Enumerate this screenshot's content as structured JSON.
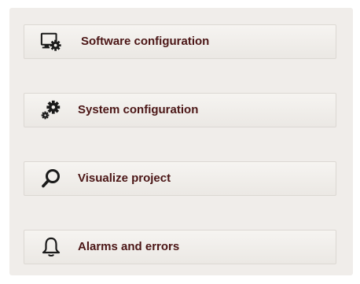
{
  "menu": {
    "items": [
      {
        "label": "Software configuration",
        "icon": "monitor-gear-icon"
      },
      {
        "label": "System configuration",
        "icon": "gears-icon"
      },
      {
        "label": "Visualize project",
        "icon": "magnifier-icon"
      },
      {
        "label": "Alarms and errors",
        "icon": "bell-icon"
      }
    ]
  },
  "colors": {
    "text": "#4b1616",
    "icon": "#1a1a1a",
    "panel_background": "#f0edea",
    "button_background": "#efece8",
    "button_border": "#dcd8d3"
  }
}
